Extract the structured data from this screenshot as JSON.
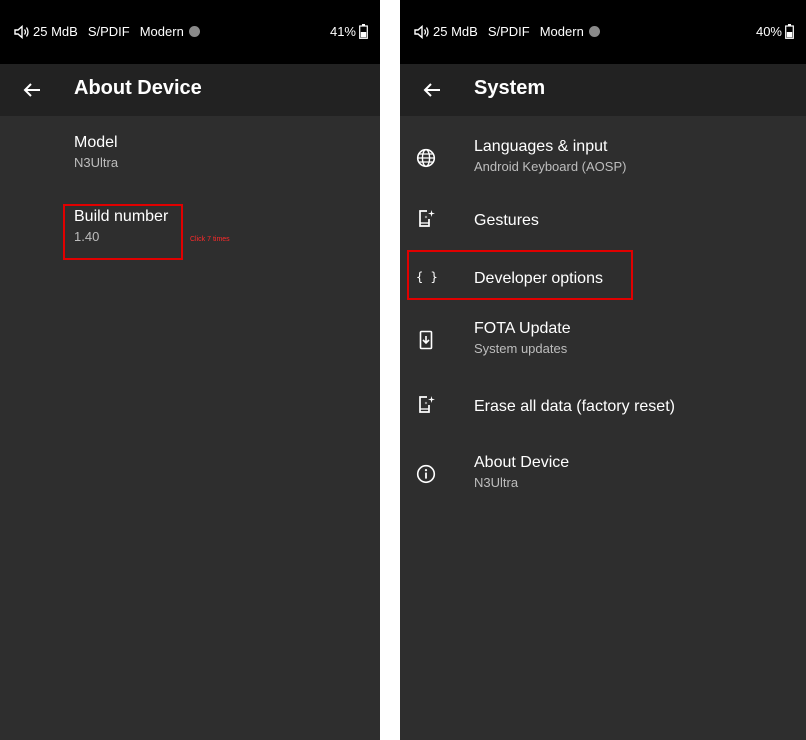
{
  "left": {
    "status": {
      "volume": "25 MdB",
      "spdif": "S/PDIF",
      "mode": "Modern",
      "battery": "41%"
    },
    "toolbar": {
      "title": "About Device"
    },
    "items": [
      {
        "title": "Model",
        "subtitle": "N3Ultra"
      },
      {
        "title": "Build number",
        "subtitle": "1.40"
      }
    ],
    "hint": "Click 7 times"
  },
  "right": {
    "status": {
      "volume": "25 MdB",
      "spdif": "S/PDIF",
      "mode": "Modern",
      "battery": "40%"
    },
    "toolbar": {
      "title": "System"
    },
    "items": [
      {
        "title": "Languages & input",
        "subtitle": "Android Keyboard (AOSP)",
        "icon": "globe-icon"
      },
      {
        "title": "Gestures",
        "subtitle": "",
        "icon": "phone-sparkle-icon"
      },
      {
        "title": "Developer options",
        "subtitle": "",
        "icon": "braces-icon",
        "icon_text": "{ }"
      },
      {
        "title": "FOTA Update",
        "subtitle": "System updates",
        "icon": "system-update-icon"
      },
      {
        "title": "Erase all data (factory reset)",
        "subtitle": "",
        "icon": "phone-sparkle-icon"
      },
      {
        "title": "About Device",
        "subtitle": "N3Ultra",
        "icon": "info-icon"
      }
    ]
  },
  "colors": {
    "highlight": "#e00000",
    "background": "#2e2e2e",
    "toolbar": "#222222",
    "statusbar": "#000000"
  }
}
